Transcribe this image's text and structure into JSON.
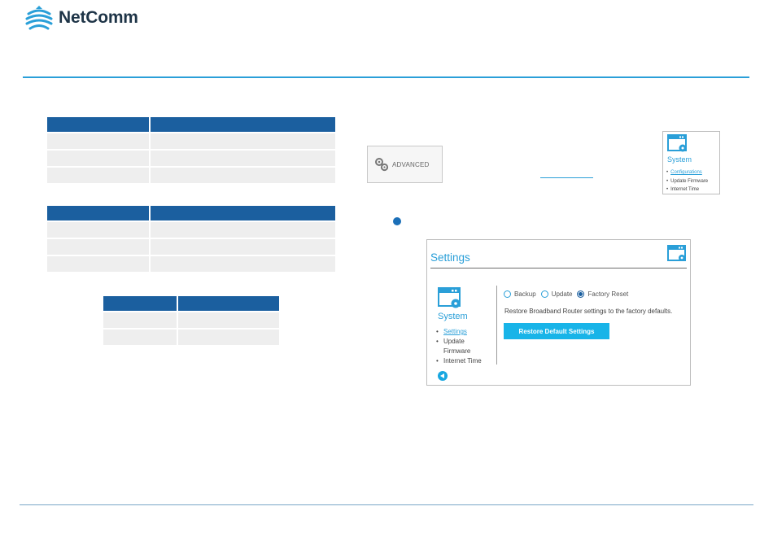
{
  "header": {
    "brand": "NetComm"
  },
  "advanced_button": {
    "label": "ADVANCED",
    "icon": "gears-icon"
  },
  "system_card": {
    "title": "System",
    "items": [
      "Configurations",
      "Update Firmware",
      "Internet Time"
    ]
  },
  "settings_panel": {
    "title": "Settings",
    "system_title": "System",
    "nav_items": [
      "Settings",
      "Update",
      "Firmware",
      "Internet Time"
    ],
    "radio_options": [
      "Backup",
      "Update",
      "Factory Reset"
    ],
    "selected_option": "Factory Reset",
    "description": "Restore Broadband Router settings to the factory defaults.",
    "button_label": "Restore Default Settings"
  },
  "colors": {
    "table_header": "#1b5f9f",
    "table_row": "#eeeeee",
    "accent": "#2a9fd8",
    "button": "#18b4e8",
    "brand_text": "#1e3447"
  }
}
